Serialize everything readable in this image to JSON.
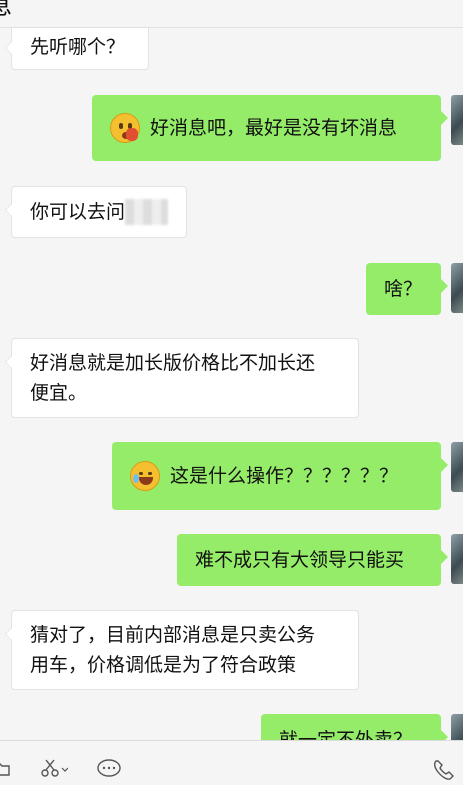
{
  "header": {
    "title_partial": "息"
  },
  "messages": [
    {
      "side": "in",
      "text": "先听哪个？"
    },
    {
      "side": "out",
      "emoji": "zipper-mouth-bloody-hand-emoji",
      "text": "好消息吧，最好是没有坏消息"
    },
    {
      "side": "in",
      "text": "你可以去问",
      "redacted": true
    },
    {
      "side": "out",
      "text": "啥？"
    },
    {
      "side": "in",
      "lines": [
        "好消息就是加长版价格比不加长还",
        "便宜。"
      ]
    },
    {
      "side": "out",
      "emoji": "tears-of-joy-emoji",
      "text": "这是什么操作？？？？？？"
    },
    {
      "side": "out",
      "text": "难不成只有大领导只能买"
    },
    {
      "side": "in",
      "lines": [
        "猜对了，目前内部消息是只卖公务",
        "用车，价格调低是为了符合政策"
      ]
    },
    {
      "side": "out",
      "text": "就一定不外卖？"
    }
  ],
  "toolbar": {
    "icons": [
      "folder-icon",
      "scissors-icon",
      "chat-bubble-icon",
      "phone-icon"
    ]
  },
  "colors": {
    "outgoing_bubble": "#95ec69",
    "incoming_bubble": "#ffffff",
    "background": "#f5f5f5"
  }
}
